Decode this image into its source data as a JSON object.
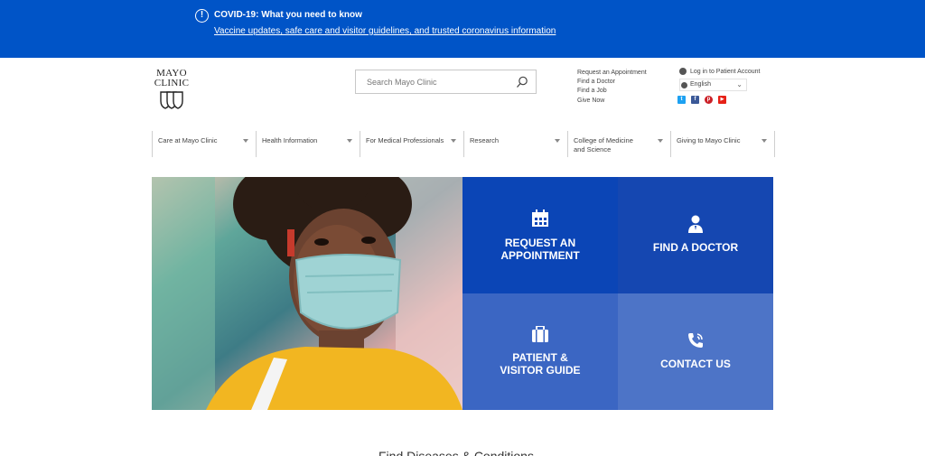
{
  "banner": {
    "icon": "info-icon",
    "title": "COVID-19: What you need to know",
    "link_text": "Vaccine updates, safe care and visitor guidelines, and trusted coronavirus information"
  },
  "logo": {
    "line1": "MAYO",
    "line2": "CLINIC"
  },
  "search": {
    "placeholder": "Search Mayo Clinic",
    "icon": "search-icon"
  },
  "utility_links": [
    "Request an Appointment",
    "Find a Doctor",
    "Find a Job",
    "Give Now"
  ],
  "account": {
    "label": "Log in to Patient Account",
    "icon": "user-icon"
  },
  "language": {
    "selected": "English",
    "icon": "globe-icon"
  },
  "social": [
    {
      "name": "twitter-icon",
      "glyph": "t",
      "color": "#1da1f2"
    },
    {
      "name": "facebook-icon",
      "glyph": "f",
      "color": "#3b5998"
    },
    {
      "name": "pinterest-icon",
      "glyph": "p",
      "color": "#cb2027"
    },
    {
      "name": "youtube-icon",
      "glyph": "▶",
      "color": "#e62117"
    }
  ],
  "nav": [
    {
      "label": "Care at Mayo Clinic"
    },
    {
      "label": "Health Information"
    },
    {
      "label": "For Medical Professionals"
    },
    {
      "label": "Research"
    },
    {
      "label": "College of Medicine and Science"
    },
    {
      "label": "Giving to Mayo Clinic"
    }
  ],
  "tiles": [
    {
      "label": "REQUEST AN APPOINTMENT",
      "icon": "calendar-icon"
    },
    {
      "label": "FIND A DOCTOR",
      "icon": "doctor-icon"
    },
    {
      "label": "PATIENT & VISITOR GUIDE",
      "icon": "briefcase-icon"
    },
    {
      "label": "CONTACT US",
      "icon": "phone-icon"
    }
  ],
  "section": {
    "title": "Find Diseases & Conditions"
  },
  "colors": {
    "banner": "#0054c7",
    "tile1": "#0b45b6",
    "tile2": "#1547b1",
    "tile3": "#3b66c3",
    "tile4": "#4d74c7"
  }
}
